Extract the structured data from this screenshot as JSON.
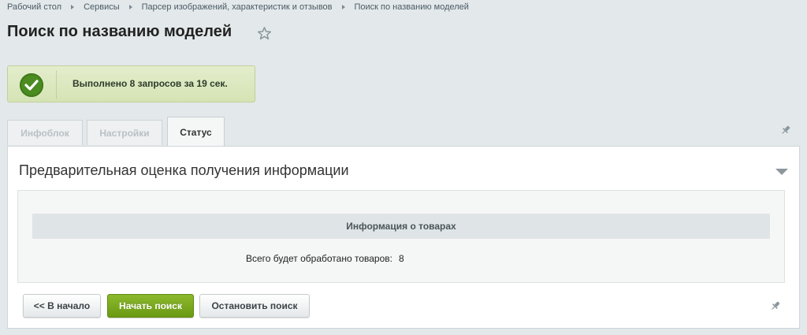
{
  "breadcrumb": {
    "items": [
      "Рабочий стол",
      "Сервисы",
      "Парсер изображений, характеристик и отзывов",
      "Поиск по названию моделей"
    ]
  },
  "page": {
    "title": "Поиск по названию моделей"
  },
  "notice": {
    "message": "Выполнено 8 запросов за 19 сек.",
    "status_color": "#4b8b20"
  },
  "tabs": [
    {
      "label": "Инфоблок",
      "active": false
    },
    {
      "label": "Настройки",
      "active": false
    },
    {
      "label": "Статус",
      "active": true
    }
  ],
  "section": {
    "title": "Предварительная оценка получения информации",
    "info_header": "Информация о товарах",
    "total_label": "Всего будет обработано товаров:",
    "total_value": "8"
  },
  "buttons": {
    "back": "<< В начало",
    "start": "Начать поиск",
    "stop": "Остановить поиск"
  },
  "colors": {
    "accent_green": "#7aaa1e",
    "background": "#e3e8ea"
  }
}
